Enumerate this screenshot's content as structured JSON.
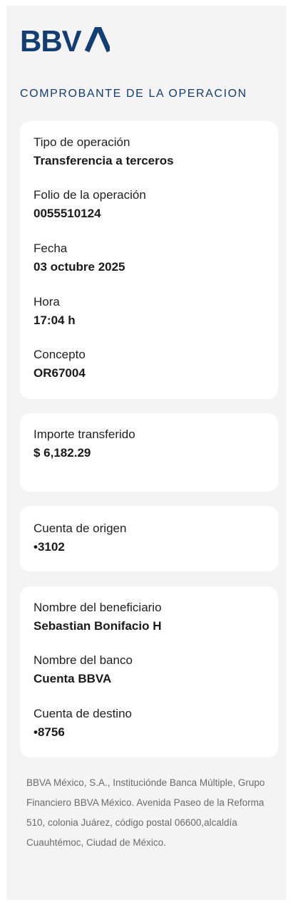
{
  "brand": {
    "logo_text": "BBVA",
    "brand_color": "#123e74"
  },
  "receipt": {
    "title": "COMPROBANTE DE LA OPERACION"
  },
  "operation_card": {
    "type_label": "Tipo de operación",
    "type_value": "Transferencia a terceros",
    "folio_label": "Folio de la operación",
    "folio_value": "0055510124",
    "date_label": "Fecha",
    "date_value": "03 octubre 2025",
    "time_label": "Hora",
    "time_value": "17:04 h",
    "concept_label": "Concepto",
    "concept_value": "OR67004"
  },
  "amount_card": {
    "label": "Importe transferido",
    "value": "$ 6,182.29"
  },
  "origin_card": {
    "label": "Cuenta de origen",
    "value": "•3102"
  },
  "beneficiary_card": {
    "name_label": "Nombre del beneficiario",
    "name_value": "Sebastian Bonifacio H",
    "bank_label": "Nombre del banco",
    "bank_value": "Cuenta BBVA",
    "dest_label": "Cuenta de destino",
    "dest_value": "•8756"
  },
  "footer": {
    "legal_text": "BBVA México, S.A., Instituciónde Banca Múltiple, Grupo Financiero BBVA México. Avenida Paseo de la Reforma 510, colonia Juárez, código postal 06600,alcaldía Cuauhtémoc, Ciudad de México."
  }
}
